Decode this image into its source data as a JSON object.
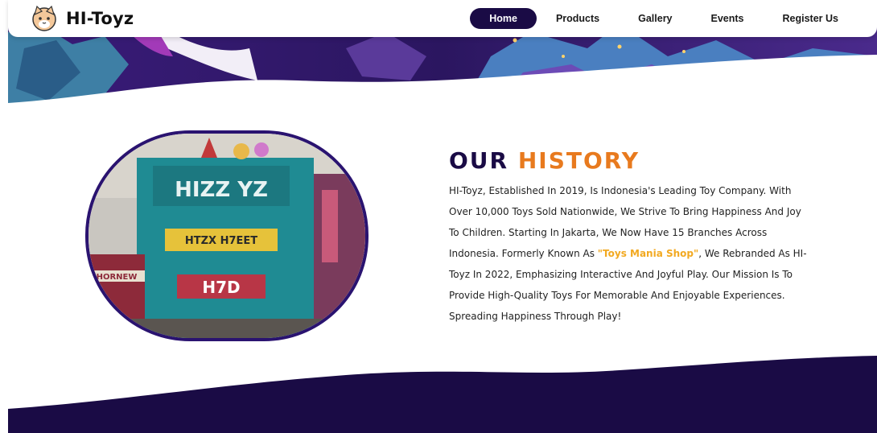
{
  "brand": {
    "name": "HI-Toyz",
    "logo_icon": "cat-face-icon"
  },
  "nav": {
    "items": [
      {
        "label": "Home",
        "active": true
      },
      {
        "label": "Products",
        "active": false
      },
      {
        "label": "Gallery",
        "active": false
      },
      {
        "label": "Events",
        "active": false
      },
      {
        "label": "Register Us",
        "active": false
      }
    ]
  },
  "history": {
    "title_part1": "OUR",
    "title_part2": "HISTORY",
    "text_before": "HI-Toyz, Established In 2019, Is Indonesia's Leading Toy Company. With Over 10,000 Toys Sold Nationwide, We Strive To Bring Happiness And Joy To Children. Starting In Jakarta, We Now Have 15 Branches Across Indonesia. Formerly Known As ",
    "highlight": "\"Toys Mania Shop\"",
    "text_after": ", We Rebranded As HI-Toyz In 2022, Emphasizing Interactive And Joyful Play. Our Mission Is To Provide High-Quality Toys For Memorable And Enjoyable Experiences. Spreading Happiness Through Play!",
    "store_sign_main": "HIZZ YZ",
    "store_sign_banner": "HTZX H7EET",
    "store_sign_lower": "H7D",
    "store_sign_side": "HORNEW"
  },
  "colors": {
    "primary_navy": "#1a0b45",
    "accent_orange": "#e87a1e",
    "highlight_yellow": "#f2a921"
  }
}
